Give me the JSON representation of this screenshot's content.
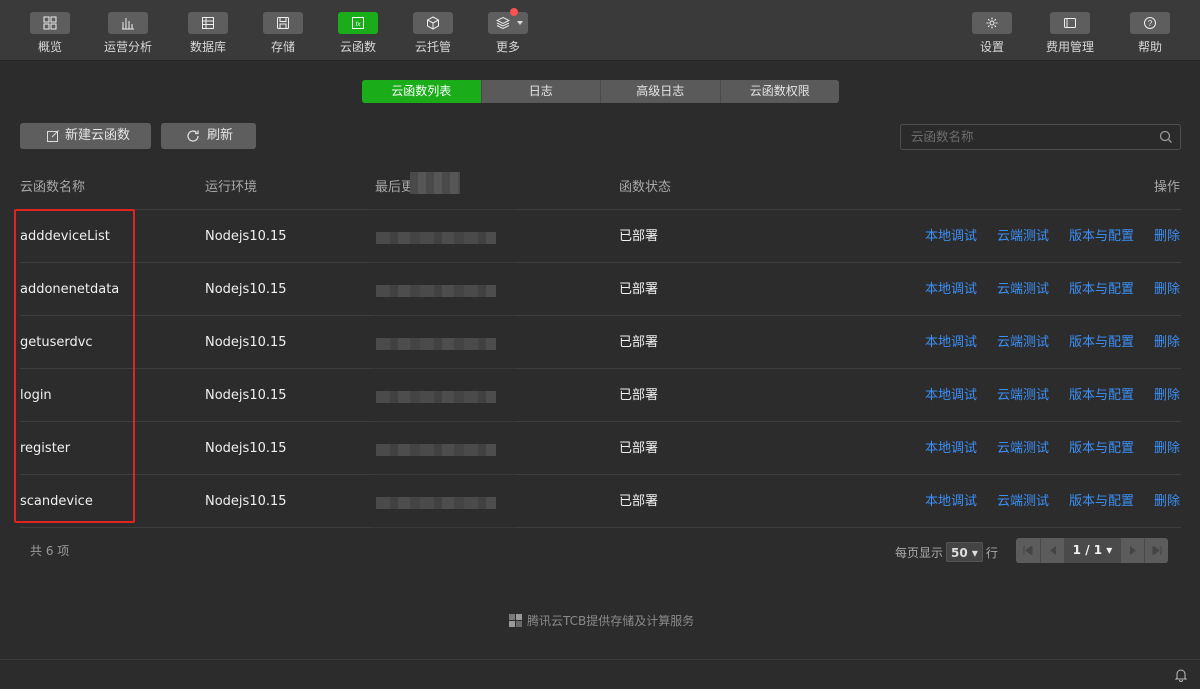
{
  "toolbar": {
    "left_items": [
      {
        "label": "概览",
        "icon": "grid-icon"
      },
      {
        "label": "运营分析",
        "icon": "bar-chart-icon"
      },
      {
        "label": "数据库",
        "icon": "database-icon"
      },
      {
        "label": "存储",
        "icon": "storage-icon"
      },
      {
        "label": "云函数",
        "icon": "fx-icon",
        "active": true
      },
      {
        "label": "云托管",
        "icon": "cube-icon"
      },
      {
        "label": "更多",
        "icon": "layers-icon"
      }
    ],
    "right_items": [
      {
        "label": "设置",
        "icon": "gear-icon"
      },
      {
        "label": "费用管理",
        "icon": "billing-icon"
      },
      {
        "label": "帮助",
        "icon": "help-icon"
      }
    ]
  },
  "tabs": [
    "云函数列表",
    "日志",
    "高级日志",
    "云函数权限"
  ],
  "actions": {
    "new_label": "新建云函数",
    "refresh_label": "刷新"
  },
  "search": {
    "placeholder": "云函数名称"
  },
  "table": {
    "headers": {
      "name": "云函数名称",
      "env": "运行环境",
      "updated": "最后更",
      "status": "函数状态",
      "ops": "操作"
    },
    "rows": [
      {
        "name": "adddeviceList",
        "env": "Nodejs10.15",
        "status": "已部署"
      },
      {
        "name": "addonenetdata",
        "env": "Nodejs10.15",
        "status": "已部署"
      },
      {
        "name": "getuserdvc",
        "env": "Nodejs10.15",
        "status": "已部署"
      },
      {
        "name": "login",
        "env": "Nodejs10.15",
        "status": "已部署"
      },
      {
        "name": "register",
        "env": "Nodejs10.15",
        "status": "已部署"
      },
      {
        "name": "scandevice",
        "env": "Nodejs10.15",
        "status": "已部署"
      }
    ],
    "row_actions": [
      "本地调试",
      "云端测试",
      "版本与配置",
      "删除"
    ]
  },
  "footer": {
    "total": "共 6 项",
    "per_page_prefix": "每页显示",
    "per_page_value": "50",
    "per_page_suffix": "行",
    "page": "1 / 1"
  },
  "credit": "腾讯云TCB提供存储及计算服务",
  "colors": {
    "accent": "#1aad19",
    "link": "#3b8ff6",
    "highlight": "#e02424",
    "badge": "#fa5151"
  }
}
